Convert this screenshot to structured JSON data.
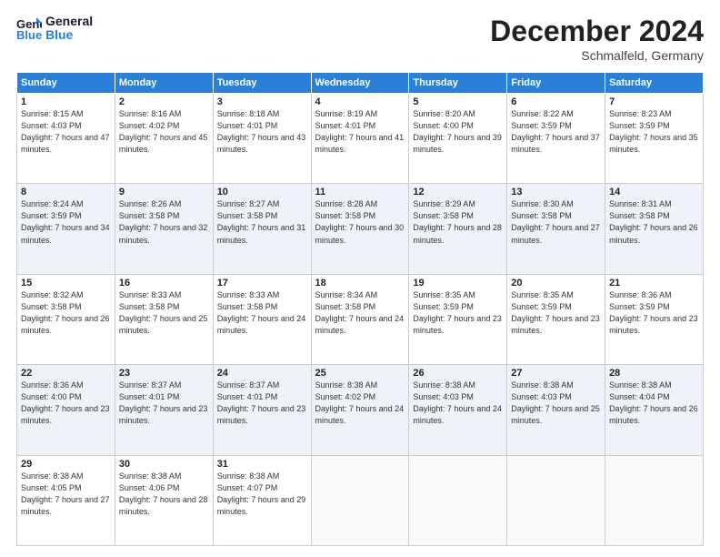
{
  "header": {
    "logo_line1": "General",
    "logo_line2": "Blue",
    "month": "December 2024",
    "location": "Schmalfeld, Germany"
  },
  "weekdays": [
    "Sunday",
    "Monday",
    "Tuesday",
    "Wednesday",
    "Thursday",
    "Friday",
    "Saturday"
  ],
  "weeks": [
    [
      {
        "day": "1",
        "sr": "Sunrise: 8:15 AM",
        "ss": "Sunset: 4:03 PM",
        "dl": "Daylight: 7 hours and 47 minutes."
      },
      {
        "day": "2",
        "sr": "Sunrise: 8:16 AM",
        "ss": "Sunset: 4:02 PM",
        "dl": "Daylight: 7 hours and 45 minutes."
      },
      {
        "day": "3",
        "sr": "Sunrise: 8:18 AM",
        "ss": "Sunset: 4:01 PM",
        "dl": "Daylight: 7 hours and 43 minutes."
      },
      {
        "day": "4",
        "sr": "Sunrise: 8:19 AM",
        "ss": "Sunset: 4:01 PM",
        "dl": "Daylight: 7 hours and 41 minutes."
      },
      {
        "day": "5",
        "sr": "Sunrise: 8:20 AM",
        "ss": "Sunset: 4:00 PM",
        "dl": "Daylight: 7 hours and 39 minutes."
      },
      {
        "day": "6",
        "sr": "Sunrise: 8:22 AM",
        "ss": "Sunset: 3:59 PM",
        "dl": "Daylight: 7 hours and 37 minutes."
      },
      {
        "day": "7",
        "sr": "Sunrise: 8:23 AM",
        "ss": "Sunset: 3:59 PM",
        "dl": "Daylight: 7 hours and 35 minutes."
      }
    ],
    [
      {
        "day": "8",
        "sr": "Sunrise: 8:24 AM",
        "ss": "Sunset: 3:59 PM",
        "dl": "Daylight: 7 hours and 34 minutes."
      },
      {
        "day": "9",
        "sr": "Sunrise: 8:26 AM",
        "ss": "Sunset: 3:58 PM",
        "dl": "Daylight: 7 hours and 32 minutes."
      },
      {
        "day": "10",
        "sr": "Sunrise: 8:27 AM",
        "ss": "Sunset: 3:58 PM",
        "dl": "Daylight: 7 hours and 31 minutes."
      },
      {
        "day": "11",
        "sr": "Sunrise: 8:28 AM",
        "ss": "Sunset: 3:58 PM",
        "dl": "Daylight: 7 hours and 30 minutes."
      },
      {
        "day": "12",
        "sr": "Sunrise: 8:29 AM",
        "ss": "Sunset: 3:58 PM",
        "dl": "Daylight: 7 hours and 28 minutes."
      },
      {
        "day": "13",
        "sr": "Sunrise: 8:30 AM",
        "ss": "Sunset: 3:58 PM",
        "dl": "Daylight: 7 hours and 27 minutes."
      },
      {
        "day": "14",
        "sr": "Sunrise: 8:31 AM",
        "ss": "Sunset: 3:58 PM",
        "dl": "Daylight: 7 hours and 26 minutes."
      }
    ],
    [
      {
        "day": "15",
        "sr": "Sunrise: 8:32 AM",
        "ss": "Sunset: 3:58 PM",
        "dl": "Daylight: 7 hours and 26 minutes."
      },
      {
        "day": "16",
        "sr": "Sunrise: 8:33 AM",
        "ss": "Sunset: 3:58 PM",
        "dl": "Daylight: 7 hours and 25 minutes."
      },
      {
        "day": "17",
        "sr": "Sunrise: 8:33 AM",
        "ss": "Sunset: 3:58 PM",
        "dl": "Daylight: 7 hours and 24 minutes."
      },
      {
        "day": "18",
        "sr": "Sunrise: 8:34 AM",
        "ss": "Sunset: 3:58 PM",
        "dl": "Daylight: 7 hours and 24 minutes."
      },
      {
        "day": "19",
        "sr": "Sunrise: 8:35 AM",
        "ss": "Sunset: 3:59 PM",
        "dl": "Daylight: 7 hours and 23 minutes."
      },
      {
        "day": "20",
        "sr": "Sunrise: 8:35 AM",
        "ss": "Sunset: 3:59 PM",
        "dl": "Daylight: 7 hours and 23 minutes."
      },
      {
        "day": "21",
        "sr": "Sunrise: 8:36 AM",
        "ss": "Sunset: 3:59 PM",
        "dl": "Daylight: 7 hours and 23 minutes."
      }
    ],
    [
      {
        "day": "22",
        "sr": "Sunrise: 8:36 AM",
        "ss": "Sunset: 4:00 PM",
        "dl": "Daylight: 7 hours and 23 minutes."
      },
      {
        "day": "23",
        "sr": "Sunrise: 8:37 AM",
        "ss": "Sunset: 4:01 PM",
        "dl": "Daylight: 7 hours and 23 minutes."
      },
      {
        "day": "24",
        "sr": "Sunrise: 8:37 AM",
        "ss": "Sunset: 4:01 PM",
        "dl": "Daylight: 7 hours and 23 minutes."
      },
      {
        "day": "25",
        "sr": "Sunrise: 8:38 AM",
        "ss": "Sunset: 4:02 PM",
        "dl": "Daylight: 7 hours and 24 minutes."
      },
      {
        "day": "26",
        "sr": "Sunrise: 8:38 AM",
        "ss": "Sunset: 4:03 PM",
        "dl": "Daylight: 7 hours and 24 minutes."
      },
      {
        "day": "27",
        "sr": "Sunrise: 8:38 AM",
        "ss": "Sunset: 4:03 PM",
        "dl": "Daylight: 7 hours and 25 minutes."
      },
      {
        "day": "28",
        "sr": "Sunrise: 8:38 AM",
        "ss": "Sunset: 4:04 PM",
        "dl": "Daylight: 7 hours and 26 minutes."
      }
    ],
    [
      {
        "day": "29",
        "sr": "Sunrise: 8:38 AM",
        "ss": "Sunset: 4:05 PM",
        "dl": "Daylight: 7 hours and 27 minutes."
      },
      {
        "day": "30",
        "sr": "Sunrise: 8:38 AM",
        "ss": "Sunset: 4:06 PM",
        "dl": "Daylight: 7 hours and 28 minutes."
      },
      {
        "day": "31",
        "sr": "Sunrise: 8:38 AM",
        "ss": "Sunset: 4:07 PM",
        "dl": "Daylight: 7 hours and 29 minutes."
      },
      null,
      null,
      null,
      null
    ]
  ]
}
